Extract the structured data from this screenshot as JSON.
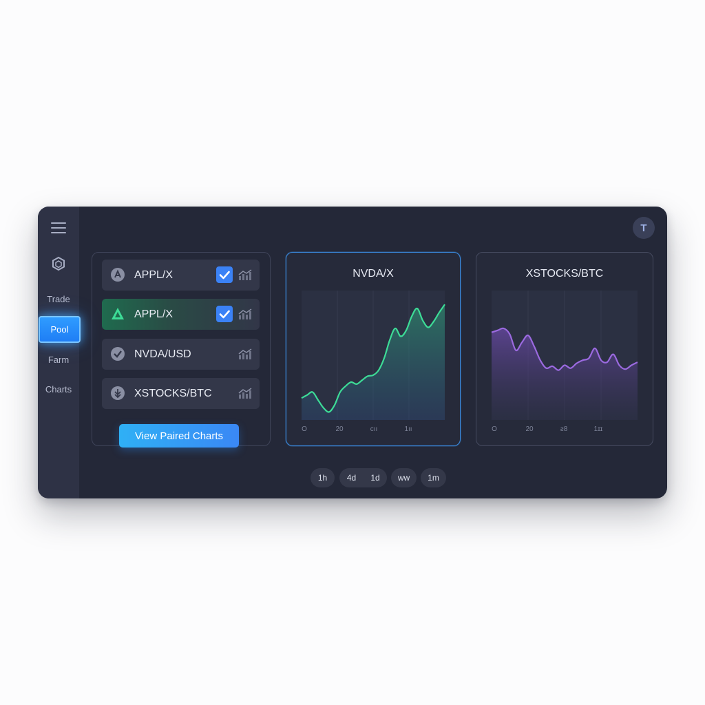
{
  "sidebar": {
    "items": [
      {
        "label": "Trade"
      },
      {
        "label": "Pool"
      },
      {
        "label": "Farm"
      },
      {
        "label": "Charts"
      }
    ]
  },
  "header": {
    "avatar_initial": "T"
  },
  "pairs": [
    {
      "label": "APPL/X",
      "checked": true,
      "icon": "apple-token-icon"
    },
    {
      "label": "APPL/X",
      "checked": true,
      "icon": "arbitrum-token-icon"
    },
    {
      "label": "NVDA/USD",
      "checked": false,
      "icon": "nvidia-token-icon"
    },
    {
      "label": "XSTOCKS/BTC",
      "checked": false,
      "icon": "xstocks-token-icon"
    }
  ],
  "view_button": {
    "label": "View Paired Charts"
  },
  "charts": [
    {
      "title": "NVDA/X",
      "color": "#3ddc97",
      "x_ticks": [
        "O",
        "20",
        "cıı",
        "1ıı"
      ],
      "chart_data": {
        "type": "area",
        "values": [
          22,
          25,
          28,
          20,
          12,
          8,
          15,
          28,
          34,
          38,
          36,
          40,
          44,
          45,
          50,
          62,
          80,
          92,
          84,
          90,
          104,
          112,
          100,
          93,
          99,
          108,
          116
        ],
        "ylim": [
          0,
          130
        ]
      }
    },
    {
      "title": "XSTOCKS/BTC",
      "color": "#9b6ae0",
      "x_ticks": [
        "O",
        "20",
        "ƨ8",
        "1ɪɪ"
      ],
      "chart_data": {
        "type": "area",
        "values": [
          88,
          90,
          92,
          86,
          70,
          78,
          85,
          74,
          60,
          52,
          54,
          50,
          55,
          52,
          57,
          60,
          62,
          72,
          60,
          58,
          66,
          55,
          51,
          55,
          58
        ],
        "ylim": [
          0,
          130
        ]
      }
    }
  ],
  "time_ranges": [
    {
      "label": "1h"
    },
    {
      "label": "4d"
    },
    {
      "label": "1d"
    },
    {
      "label": "ww"
    },
    {
      "label": "1m"
    }
  ]
}
